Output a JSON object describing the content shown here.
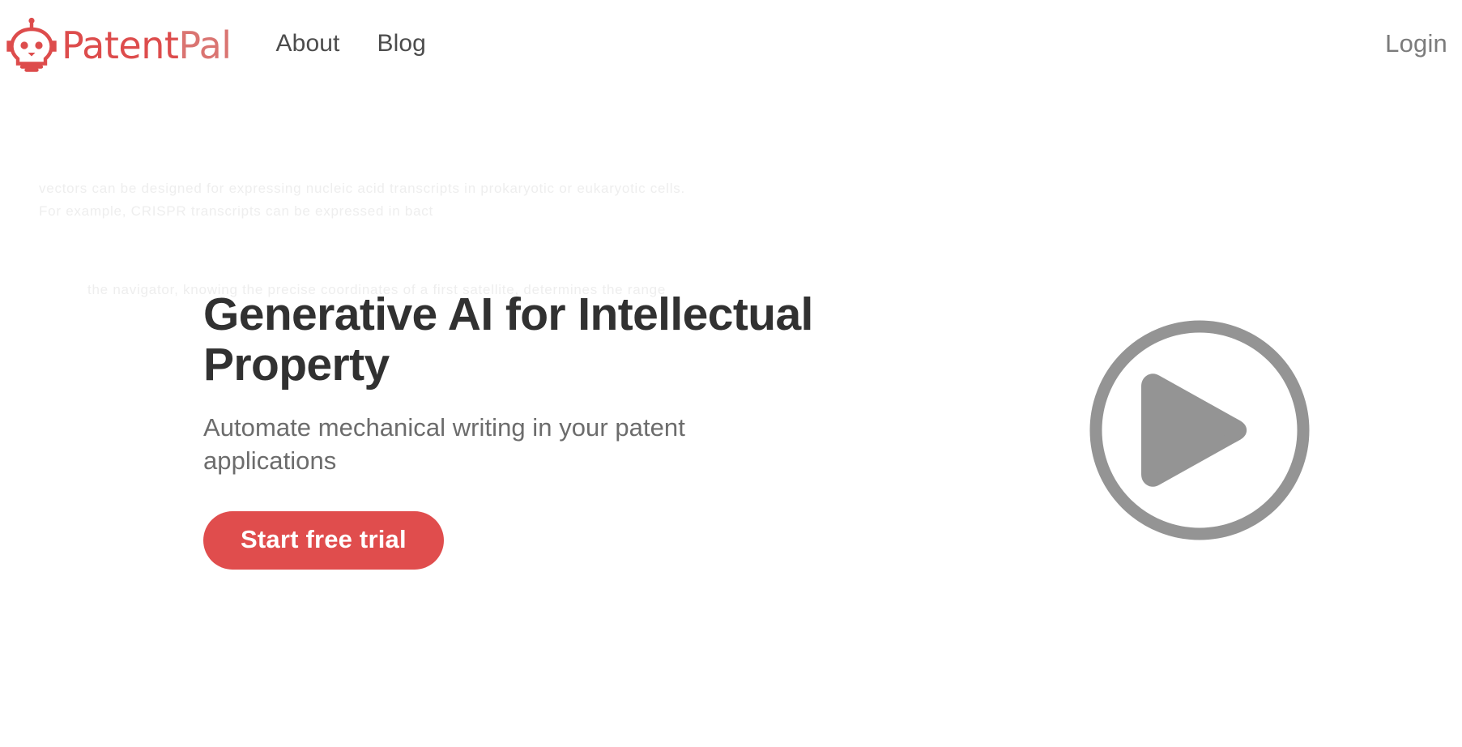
{
  "brand": {
    "name_part_1": "Patent",
    "name_part_2": "Pal",
    "mark_icon": "robot-lightbulb-icon",
    "color_primary": "#dd4c4c",
    "color_secondary": "#da7471"
  },
  "nav": {
    "links": [
      {
        "label": "About"
      },
      {
        "label": "Blog"
      }
    ],
    "login_label": "Login",
    "login_color": "#7b7b7b"
  },
  "watermark": {
    "block_1": "vectors can be designed for expressing nucleic acid transcripts in prokaryotic or eukaryotic cells. For example, CRISPR transcripts can be expressed in bact",
    "block_2": "the navigator, knowing the precise coordinates of a first satellite, determines the range",
    "color": "#eeeeee"
  },
  "hero": {
    "title": "Generative AI for Intellectual Property",
    "subtitle": "Automate mechanical writing in your patent applications",
    "cta_label": "Start free trial",
    "cta_color": "#e04d4d",
    "title_color": "#313131",
    "subtitle_color": "#6c6c6c"
  },
  "media": {
    "play_icon": "play-circle-icon",
    "play_color": "#949494"
  }
}
